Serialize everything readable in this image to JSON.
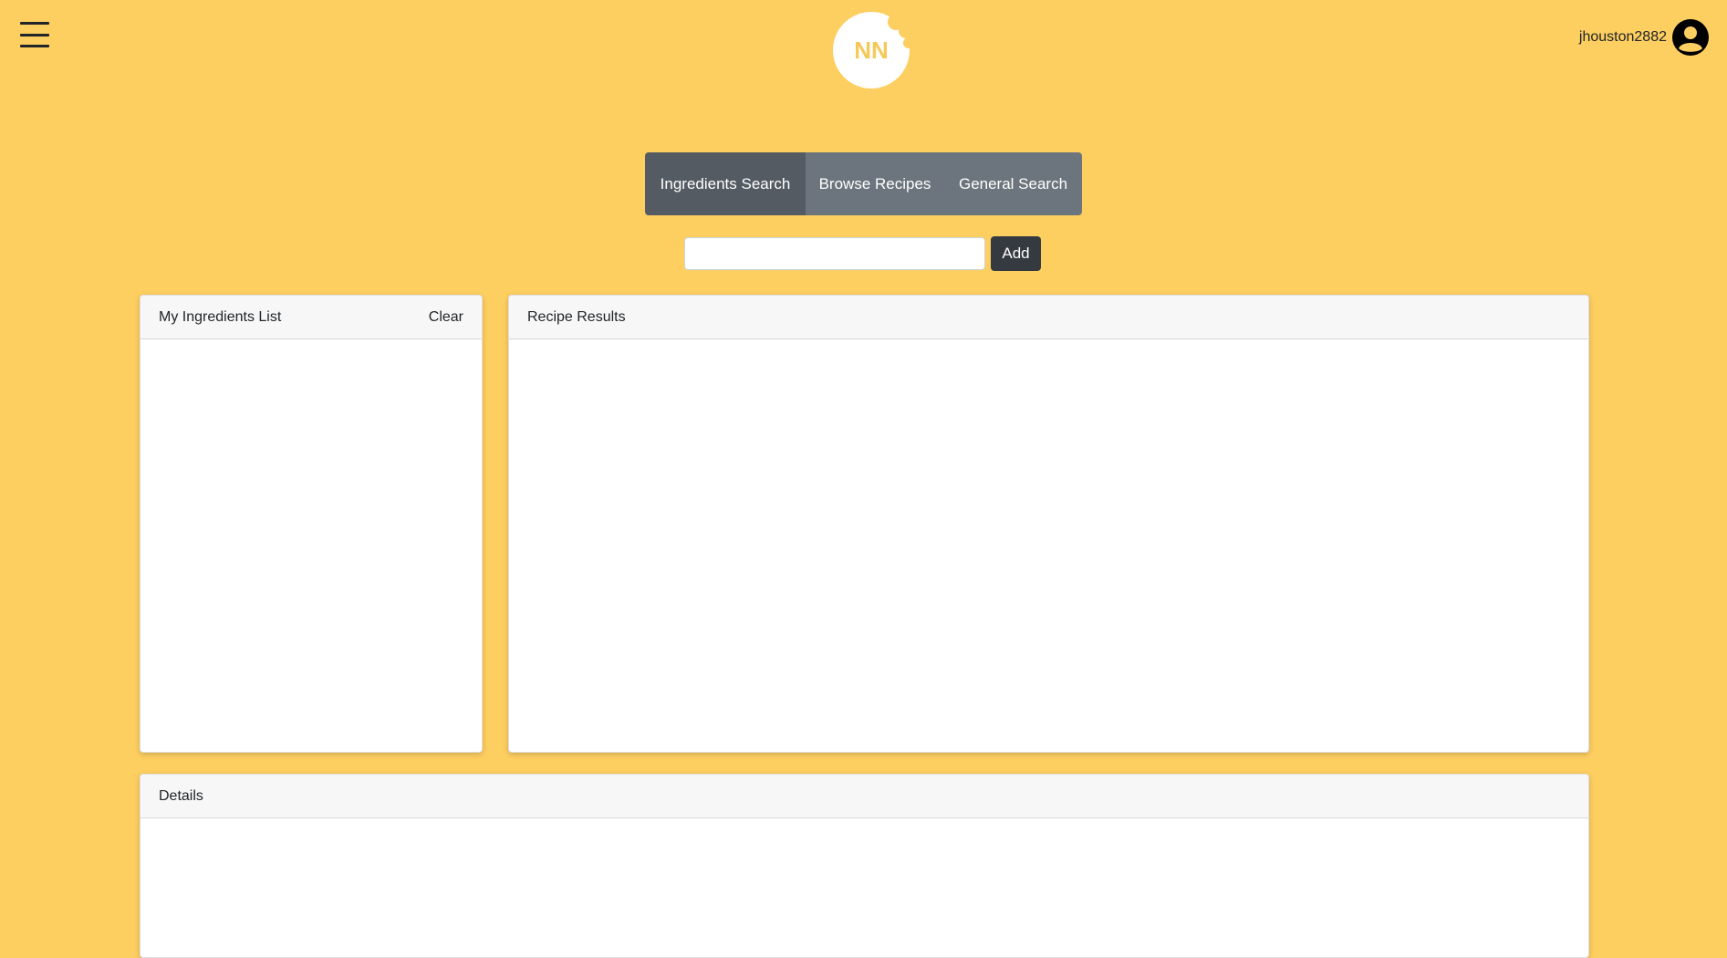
{
  "header": {
    "menu_icon": "hamburger-icon",
    "logo": {
      "text": "NN",
      "icon": "bitten-cookie-logo"
    },
    "user": {
      "username": "jhouston2882",
      "icon": "user-avatar-icon"
    }
  },
  "tabs": [
    {
      "label": "Ingredients Search",
      "active": true
    },
    {
      "label": "Browse Recipes",
      "active": false
    },
    {
      "label": "General Search",
      "active": false
    }
  ],
  "search": {
    "value": "",
    "placeholder": "",
    "add_label": "Add"
  },
  "ingredients_card": {
    "title": "My Ingredients List",
    "clear_label": "Clear",
    "items": []
  },
  "results_card": {
    "title": "Recipe Results",
    "items": []
  },
  "details_card": {
    "title": "Details"
  },
  "colors": {
    "background": "#fdce60",
    "tab_active": "#545b62",
    "tab_inactive": "#6c757d",
    "add_button": "#343a40",
    "logo_text": "#f5c85a"
  }
}
